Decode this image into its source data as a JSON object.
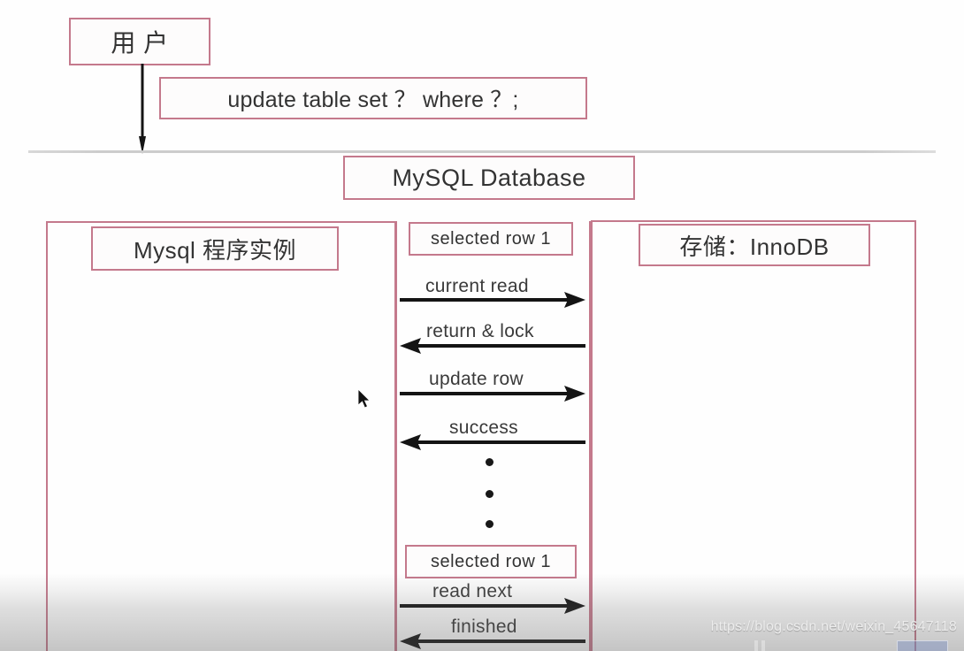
{
  "diagram": {
    "title_boxes": {
      "user": "用  户",
      "sql_statement": "update table set ？ where ？;",
      "database": "MySQL   Database",
      "mysql_instance": "Mysql 程序实例",
      "storage_engine": "存储：InnoDB"
    },
    "messages": {
      "selected_row_top": "selected  row 1",
      "selected_row_bottom": "selected  row 1"
    },
    "exchanges": [
      {
        "label": "current read",
        "direction": "right"
      },
      {
        "label": "return  &  lock",
        "direction": "left"
      },
      {
        "label": "update  row",
        "direction": "right"
      },
      {
        "label": "success",
        "direction": "left"
      },
      {
        "label": "read   next",
        "direction": "right"
      },
      {
        "label": "finished",
        "direction": "left"
      }
    ],
    "ellipsis_dots": 3,
    "colors": {
      "box_border": "#c4798c",
      "arrow": "#141414",
      "text": "#333333",
      "divider": "#cccccc"
    }
  },
  "overlay": {
    "watermark": "https://blog.csdn.net/weixin_45647118"
  }
}
